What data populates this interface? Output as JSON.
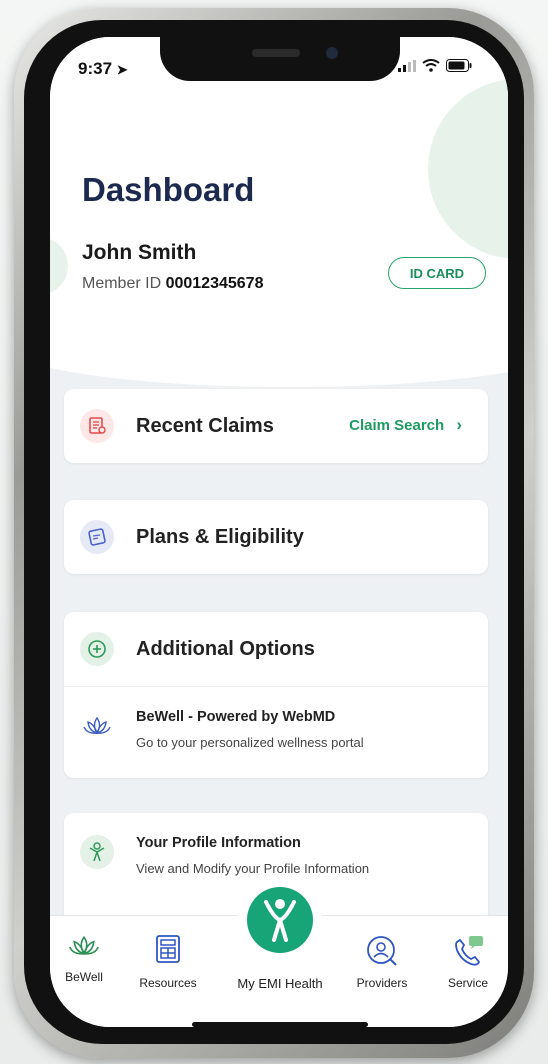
{
  "status_bar": {
    "time": "9:37"
  },
  "header": {
    "title": "Dashboard",
    "member_name": "John Smith",
    "member_id_label": "Member ID",
    "member_id_value": "00012345678",
    "id_card_button": "ID CARD"
  },
  "cards": {
    "recent_claims": {
      "title": "Recent Claims",
      "link": "Claim Search",
      "link_chevron": "›"
    },
    "plans": {
      "title": "Plans & Eligibility"
    },
    "additional": {
      "title": "Additional Options",
      "bewell_title": "BeWell - Powered by WebMD",
      "bewell_desc": "Go to your personalized wellness portal"
    },
    "profile": {
      "title": "Your Profile Information",
      "desc": "View and Modify your Profile Information"
    }
  },
  "tabbar": {
    "tabs": [
      {
        "label": "BeWell",
        "icon": "lotus-icon"
      },
      {
        "label": "Resources",
        "icon": "calculator-icon"
      },
      {
        "label": "My EMI Health",
        "icon": "person-logo-icon"
      },
      {
        "label": "Providers",
        "icon": "provider-search-icon"
      },
      {
        "label": "Service",
        "icon": "phone-chat-icon"
      }
    ]
  },
  "colors": {
    "brand_green": "#17a477",
    "title_navy": "#1d2a4f",
    "link_green": "#1e9b63"
  }
}
